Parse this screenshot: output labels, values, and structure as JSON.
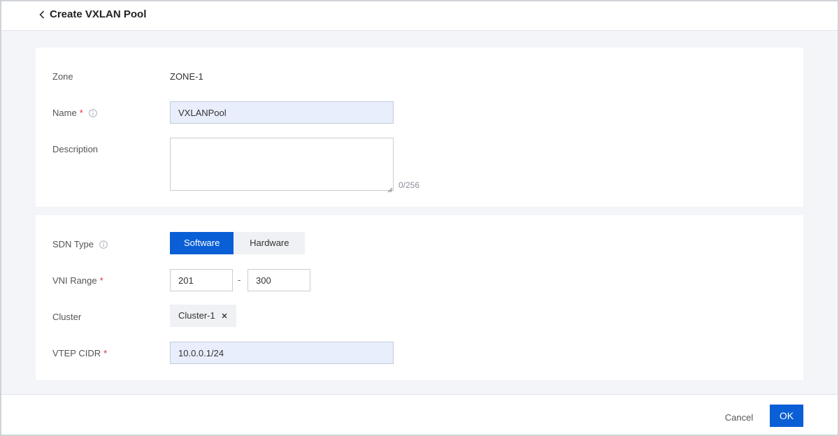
{
  "header": {
    "title": "Create VXLAN Pool",
    "back_icon": "chevron-left-icon"
  },
  "basic": {
    "zone_label": "Zone",
    "zone_value": "ZONE-1",
    "name_label": "Name",
    "name_required": "*",
    "name_value": "VXLANPool",
    "description_label": "Description",
    "description_value": "",
    "description_counter": "0/256"
  },
  "network": {
    "sdn_type_label": "SDN Type",
    "sdn_options": [
      "Software",
      "Hardware"
    ],
    "sdn_selected": "Software",
    "vni_label": "VNI Range",
    "vni_required": "*",
    "vni_start": "201",
    "vni_separator": "-",
    "vni_end": "300",
    "cluster_label": "Cluster",
    "cluster_tag": "Cluster-1",
    "vtep_label": "VTEP CIDR",
    "vtep_required": "*",
    "vtep_value": "10.0.0.1/24"
  },
  "footer": {
    "cancel_label": "Cancel",
    "ok_label": "OK"
  },
  "colors": {
    "primary": "#0a5fd6",
    "required": "#e03131",
    "page_bg": "#f4f5f8",
    "input_filled_bg": "#e8eefc"
  }
}
